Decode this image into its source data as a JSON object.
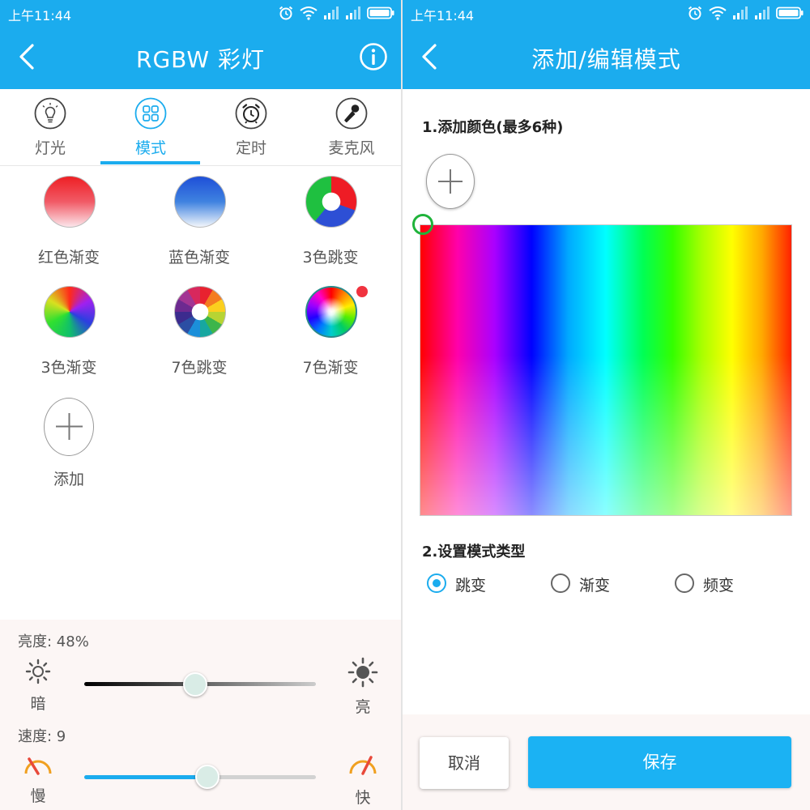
{
  "status_bar": {
    "time": "上午11:44",
    "icons": [
      "alarm-icon",
      "wifi-icon",
      "signal-icon",
      "signal-icon",
      "battery-icon"
    ]
  },
  "left_screen": {
    "title": "RGBW 彩灯",
    "back_icon": "chevron-left-icon",
    "info_icon": "info-icon",
    "tabs": [
      {
        "label": "灯光",
        "icon": "bulb-icon",
        "active": false
      },
      {
        "label": "模式",
        "icon": "grid-icon",
        "active": true
      },
      {
        "label": "定时",
        "icon": "alarm-clock-icon",
        "active": false
      },
      {
        "label": "麦克风",
        "icon": "microphone-icon",
        "active": false
      }
    ],
    "modes": [
      {
        "label": "红色渐变",
        "icon": "red-gradient-icon"
      },
      {
        "label": "蓝色渐变",
        "icon": "blue-gradient-icon"
      },
      {
        "label": "3色跳变",
        "icon": "three-color-jump-icon"
      },
      {
        "label": "3色渐变",
        "icon": "three-color-gradient-icon"
      },
      {
        "label": "7色跳变",
        "icon": "seven-color-jump-icon"
      },
      {
        "label": "7色渐变",
        "icon": "seven-color-gradient-icon",
        "badge_color": "#f0333f"
      },
      {
        "label": "添加",
        "icon": "plus-icon"
      }
    ],
    "brightness": {
      "label": "亮度: 48%",
      "value": 48,
      "min_label": "暗",
      "max_label": "亮"
    },
    "speed": {
      "label": "速度: 9",
      "value": 9,
      "fill_fraction": 0.53,
      "min_label": "慢",
      "max_label": "快"
    }
  },
  "right_screen": {
    "title": "添加/编辑模式",
    "back_icon": "chevron-left-icon",
    "section1_title": "1.添加颜色(最多6种)",
    "add_color_icon": "plus-icon",
    "section2_title": "2.设置模式类型",
    "mode_types": [
      {
        "label": "跳变",
        "checked": true
      },
      {
        "label": "渐变",
        "checked": false
      },
      {
        "label": "频变",
        "checked": false
      }
    ],
    "cancel_label": "取消",
    "save_label": "保存"
  },
  "colors": {
    "accent": "#1bacee",
    "save_button": "#1bb2f3",
    "badge": "#f0333f",
    "panel_bg": "#fcf6f5"
  }
}
